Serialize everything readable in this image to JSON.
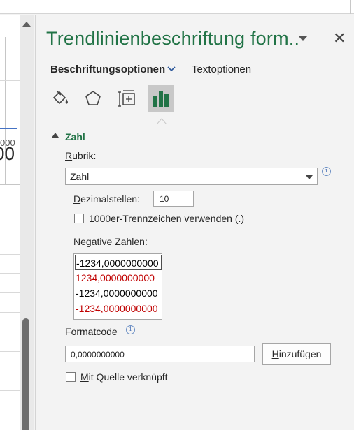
{
  "pane": {
    "title": "Trendlinienbeschriftung form..",
    "close_glyph": "✕",
    "dropdown_icon": "chevron-down-icon"
  },
  "tabs": {
    "label_options": "Beschriftungsoptionen",
    "text_options": "Textoptionen"
  },
  "icon_tabs": [
    {
      "icon": "paint-bucket-icon",
      "label": "Füllung und Linie",
      "active": false
    },
    {
      "icon": "pentagon-icon",
      "label": "Effekte",
      "active": false
    },
    {
      "icon": "size-properties-icon",
      "label": "Größe und Eigenschaften",
      "active": false
    },
    {
      "icon": "bar-chart-icon",
      "label": "Beschriftungsoptionen",
      "active": true
    }
  ],
  "section": {
    "title": "Zahl",
    "rubrik_label_mnemonic": "R",
    "rubrik_label_rest": "ubrik:",
    "rubrik_value": "Zahl",
    "decimals_label_mnemonic": "D",
    "decimals_label_rest": "ezimalstellen:",
    "decimals_value": "10",
    "thousands_mnemonic": "1",
    "thousands_rest": "000er-Trennzeichen verwenden (.)",
    "thousands_checked": false,
    "negative_label_mnemonic": "N",
    "negative_label_rest": "egative Zahlen:",
    "negative_options": [
      {
        "text": "-1234,0000000000",
        "color": "#000000",
        "selected": true
      },
      {
        "text": "1234,0000000000",
        "color": "#c00000",
        "selected": false
      },
      {
        "text": "-1234,0000000000",
        "color": "#000000",
        "selected": false
      },
      {
        "text": "-1234,0000000000",
        "color": "#c00000",
        "selected": false
      }
    ],
    "formatcode_mnemonic": "F",
    "formatcode_rest": "ormatcode",
    "formatcode_value": "0,0000000000",
    "add_mnemonic": "H",
    "add_rest": "inzufügen",
    "linked_mnemonic": "M",
    "linked_rest": "it Quelle verknüpft",
    "linked_checked": false
  },
  "sheet": {
    "tick_small": "000",
    "tick_big": "00"
  },
  "colors": {
    "accent_green": "#217346",
    "negative_red": "#c00000",
    "info_blue": "#4a72b8"
  }
}
